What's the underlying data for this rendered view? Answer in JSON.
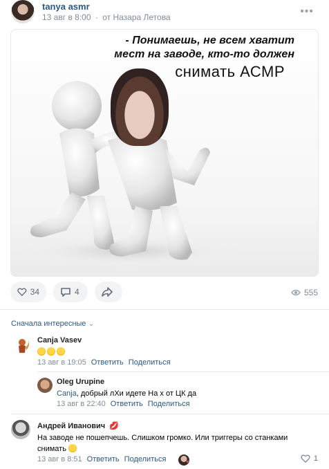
{
  "post": {
    "author": "tanya asmr",
    "date": "13 авг в 8:00",
    "from_prefix": "·",
    "from": "от Назара Летова",
    "caption_line1": "- Понимаешь, не всем хватит",
    "caption_line2": "мест на заводе, кто-то должен",
    "caption_line3": "снимать АСМР"
  },
  "actions": {
    "likes": "34",
    "comments": "4",
    "views": "555"
  },
  "comments_sort": "Сначала интересные",
  "comments": [
    {
      "name": "Canja Vasev",
      "text": "",
      "date": "13 авг в 19:05",
      "reply": "Ответить",
      "share": "Поделиться"
    },
    {
      "name": "Oleg Urupine",
      "mention": "Canja",
      "text": ", добрый лХи идете На х от ЦК да",
      "date": "13 авг в 22:40",
      "reply": "Ответить",
      "share": "Поделиться"
    },
    {
      "name": "Андрей Иванович",
      "text_line1": "На заводе не пошепчешь. Слишком громко. Или триггеры со станками",
      "text_line2": "снимать",
      "date": "13 авг в 8:51",
      "reply": "Ответить",
      "share": "Поделиться",
      "likes": "1"
    }
  ]
}
